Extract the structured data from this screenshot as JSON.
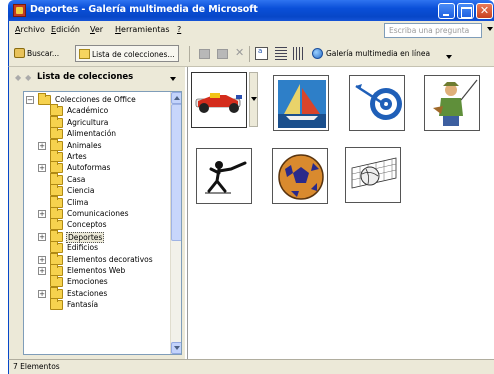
{
  "window": {
    "title": "Deportes - Galería multimedia de Microsoft",
    "close_glyph": "✕"
  },
  "menu": {
    "items": [
      {
        "accel": "A",
        "rest": "rchivo"
      },
      {
        "accel": "E",
        "rest": "dición"
      },
      {
        "accel": "V",
        "rest": "er"
      },
      {
        "accel": "H",
        "rest": "erramientas"
      },
      {
        "accel": "?",
        "rest": ""
      }
    ],
    "ask_placeholder": "Escriba una pregunta"
  },
  "toolbar": {
    "search_label": "Buscar...",
    "collection_list_label": "Lista de colecciones...",
    "online_gallery_label": "Galería multimedia en línea",
    "icons": [
      "copy-icon",
      "paste-icon",
      "delete-icon",
      "thumbnails-icon",
      "list-icon",
      "details-icon",
      "globe-icon"
    ]
  },
  "left_panel": {
    "title": "Lista de colecciones",
    "tree": [
      {
        "label": "Colecciones de Office",
        "level": 0,
        "expander": "−"
      },
      {
        "label": "Académico",
        "level": 1,
        "expander": ""
      },
      {
        "label": "Agricultura",
        "level": 1,
        "expander": ""
      },
      {
        "label": "Alimentación",
        "level": 1,
        "expander": ""
      },
      {
        "label": "Animales",
        "level": 1,
        "expander": "+"
      },
      {
        "label": "Artes",
        "level": 1,
        "expander": ""
      },
      {
        "label": "Autoformas",
        "level": 1,
        "expander": "+"
      },
      {
        "label": "Casa",
        "level": 1,
        "expander": ""
      },
      {
        "label": "Ciencia",
        "level": 1,
        "expander": ""
      },
      {
        "label": "Clima",
        "level": 1,
        "expander": ""
      },
      {
        "label": "Comunicaciones",
        "level": 1,
        "expander": "+"
      },
      {
        "label": "Conceptos",
        "level": 1,
        "expander": ""
      },
      {
        "label": "Deportes",
        "level": 1,
        "expander": "+",
        "selected": true
      },
      {
        "label": "Edificios",
        "level": 1,
        "expander": ""
      },
      {
        "label": "Elementos decorativos",
        "level": 1,
        "expander": "+"
      },
      {
        "label": "Elementos Web",
        "level": 1,
        "expander": "+"
      },
      {
        "label": "Emociones",
        "level": 1,
        "expander": ""
      },
      {
        "label": "Estaciones",
        "level": 1,
        "expander": "+"
      },
      {
        "label": "Fantasía",
        "level": 1,
        "expander": ""
      }
    ]
  },
  "clips": [
    {
      "name": "race-car-clip"
    },
    {
      "name": "sailboat-clip"
    },
    {
      "name": "target-arrow-clip"
    },
    {
      "name": "fisherman-clip"
    },
    {
      "name": "fencer-clip"
    },
    {
      "name": "soccer-ball-clip"
    },
    {
      "name": "volleyball-net-clip"
    }
  ],
  "status": {
    "text": "7 Elementos"
  },
  "colors": {
    "titlebar": "#0a4fd8",
    "chrome": "#ece9d8",
    "tree_folder": "#f6d24e"
  }
}
